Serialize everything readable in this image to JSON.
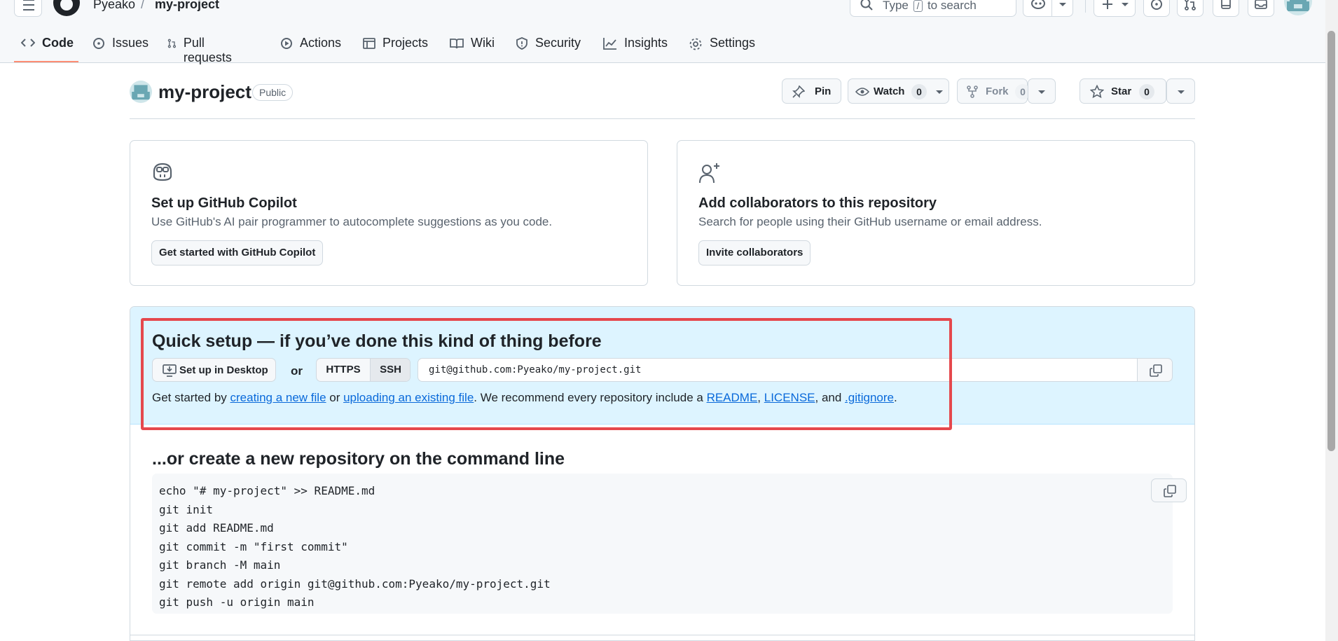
{
  "header": {
    "owner": "Pyeako",
    "separator": "/",
    "repo": "my-project",
    "search_prefix": "Type",
    "search_key": "/",
    "search_suffix": "to search"
  },
  "nav": {
    "tabs": [
      {
        "label": "Code",
        "icon": "code-icon",
        "selected": true
      },
      {
        "label": "Issues",
        "icon": "issue-icon"
      },
      {
        "label": "Pull requests",
        "icon": "pull-request-icon"
      },
      {
        "label": "Actions",
        "icon": "play-icon"
      },
      {
        "label": "Projects",
        "icon": "table-icon"
      },
      {
        "label": "Wiki",
        "icon": "book-icon"
      },
      {
        "label": "Security",
        "icon": "shield-icon"
      },
      {
        "label": "Insights",
        "icon": "graph-icon"
      },
      {
        "label": "Settings",
        "icon": "gear-icon"
      }
    ]
  },
  "repo_head": {
    "name": "my-project",
    "visibility": "Public",
    "pin_label": "Pin",
    "watch_label": "Watch",
    "watch_count": "0",
    "fork_label": "Fork",
    "fork_count": "0",
    "star_label": "Star",
    "star_count": "0"
  },
  "cards": {
    "copilot": {
      "title": "Set up GitHub Copilot",
      "description": "Use GitHub's AI pair programmer to autocomplete suggestions as you code.",
      "button": "Get started with GitHub Copilot"
    },
    "collaborators": {
      "title": "Add collaborators to this repository",
      "description": "Search for people using their GitHub username or email address.",
      "button": "Invite collaborators"
    }
  },
  "quick_setup": {
    "title": "Quick setup — if you’ve done this kind of thing before",
    "desktop_button": "Set up in Desktop",
    "or": "or",
    "https": "HTTPS",
    "ssh": "SSH",
    "selected_protocol": "SSH",
    "clone_url": "git@github.com:Pyeako/my-project.git",
    "line": {
      "t1": "Get started by ",
      "link1": "creating a new file",
      "t2": " or ",
      "link2": "uploading an existing file",
      "t3": ". We recommend every repository include a ",
      "link3": "README",
      "t4": ", ",
      "link4": "LICENSE",
      "t5": ", and ",
      "link5": ".gitignore",
      "t6": "."
    }
  },
  "command_line": {
    "title": "...or create a new repository on the command line",
    "code": "echo \"# my-project\" >> README.md\ngit init\ngit add README.md\ngit commit -m \"first commit\"\ngit branch -M main\ngit remote add origin git@github.com:Pyeako/my-project.git\ngit push -u origin main"
  },
  "colors": {
    "accent_underline": "#fd8c73",
    "link": "#0969da",
    "setup_background": "#ddf4ff",
    "highlight_border": "#e5484d"
  }
}
